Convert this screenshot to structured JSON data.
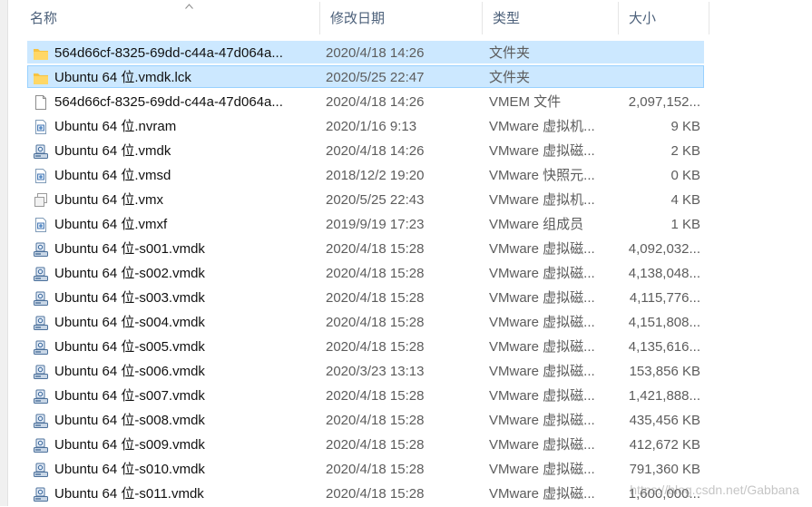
{
  "columns": {
    "name": "名称",
    "date": "修改日期",
    "type": "类型",
    "size": "大小"
  },
  "files": [
    {
      "icon": "folder-icon",
      "name": "564d66cf-8325-69dd-c44a-47d064a...",
      "date": "2020/4/18 14:26",
      "type": "文件夹",
      "size": "",
      "state": "selected"
    },
    {
      "icon": "folder-icon",
      "name": "Ubuntu 64 位.vmdk.lck",
      "date": "2020/5/25 22:47",
      "type": "文件夹",
      "size": "",
      "state": "focused"
    },
    {
      "icon": "blank-file-icon",
      "name": "564d66cf-8325-69dd-c44a-47d064a...",
      "date": "2020/4/18 14:26",
      "type": "VMEM 文件",
      "size": "2,097,152...",
      "state": ""
    },
    {
      "icon": "vmware-config-icon",
      "name": "Ubuntu 64 位.nvram",
      "date": "2020/1/16 9:13",
      "type": "VMware 虚拟机...",
      "size": "9 KB",
      "state": ""
    },
    {
      "icon": "vmware-disk-icon",
      "name": "Ubuntu 64 位.vmdk",
      "date": "2020/4/18 14:26",
      "type": "VMware 虚拟磁...",
      "size": "2 KB",
      "state": ""
    },
    {
      "icon": "vmware-config-icon",
      "name": "Ubuntu 64 位.vmsd",
      "date": "2018/12/2 19:20",
      "type": "VMware 快照元...",
      "size": "0 KB",
      "state": ""
    },
    {
      "icon": "vmware-vm-icon",
      "name": "Ubuntu 64 位.vmx",
      "date": "2020/5/25 22:43",
      "type": "VMware 虚拟机...",
      "size": "4 KB",
      "state": ""
    },
    {
      "icon": "vmware-config-icon",
      "name": "Ubuntu 64 位.vmxf",
      "date": "2019/9/19 17:23",
      "type": "VMware 组成员",
      "size": "1 KB",
      "state": ""
    },
    {
      "icon": "vmware-disk-icon",
      "name": "Ubuntu 64 位-s001.vmdk",
      "date": "2020/4/18 15:28",
      "type": "VMware 虚拟磁...",
      "size": "4,092,032...",
      "state": ""
    },
    {
      "icon": "vmware-disk-icon",
      "name": "Ubuntu 64 位-s002.vmdk",
      "date": "2020/4/18 15:28",
      "type": "VMware 虚拟磁...",
      "size": "4,138,048...",
      "state": ""
    },
    {
      "icon": "vmware-disk-icon",
      "name": "Ubuntu 64 位-s003.vmdk",
      "date": "2020/4/18 15:28",
      "type": "VMware 虚拟磁...",
      "size": "4,115,776...",
      "state": ""
    },
    {
      "icon": "vmware-disk-icon",
      "name": "Ubuntu 64 位-s004.vmdk",
      "date": "2020/4/18 15:28",
      "type": "VMware 虚拟磁...",
      "size": "4,151,808...",
      "state": ""
    },
    {
      "icon": "vmware-disk-icon",
      "name": "Ubuntu 64 位-s005.vmdk",
      "date": "2020/4/18 15:28",
      "type": "VMware 虚拟磁...",
      "size": "4,135,616...",
      "state": ""
    },
    {
      "icon": "vmware-disk-icon",
      "name": "Ubuntu 64 位-s006.vmdk",
      "date": "2020/3/23 13:13",
      "type": "VMware 虚拟磁...",
      "size": "153,856 KB",
      "state": ""
    },
    {
      "icon": "vmware-disk-icon",
      "name": "Ubuntu 64 位-s007.vmdk",
      "date": "2020/4/18 15:28",
      "type": "VMware 虚拟磁...",
      "size": "1,421,888...",
      "state": ""
    },
    {
      "icon": "vmware-disk-icon",
      "name": "Ubuntu 64 位-s008.vmdk",
      "date": "2020/4/18 15:28",
      "type": "VMware 虚拟磁...",
      "size": "435,456 KB",
      "state": ""
    },
    {
      "icon": "vmware-disk-icon",
      "name": "Ubuntu 64 位-s009.vmdk",
      "date": "2020/4/18 15:28",
      "type": "VMware 虚拟磁...",
      "size": "412,672 KB",
      "state": ""
    },
    {
      "icon": "vmware-disk-icon",
      "name": "Ubuntu 64 位-s010.vmdk",
      "date": "2020/4/18 15:28",
      "type": "VMware 虚拟磁...",
      "size": "791,360 KB",
      "state": ""
    },
    {
      "icon": "vmware-disk-icon",
      "name": "Ubuntu 64 位-s011.vmdk",
      "date": "2020/4/18 15:28",
      "type": "VMware 虚拟磁...",
      "size": "1,600,000...",
      "state": ""
    }
  ],
  "watermark": "https://blog.csdn.net/Gabbana",
  "colors": {
    "selection": "#cce8ff",
    "selection_border": "#99d1ff",
    "header_text": "#4c607a",
    "folder": "#f6c342"
  }
}
